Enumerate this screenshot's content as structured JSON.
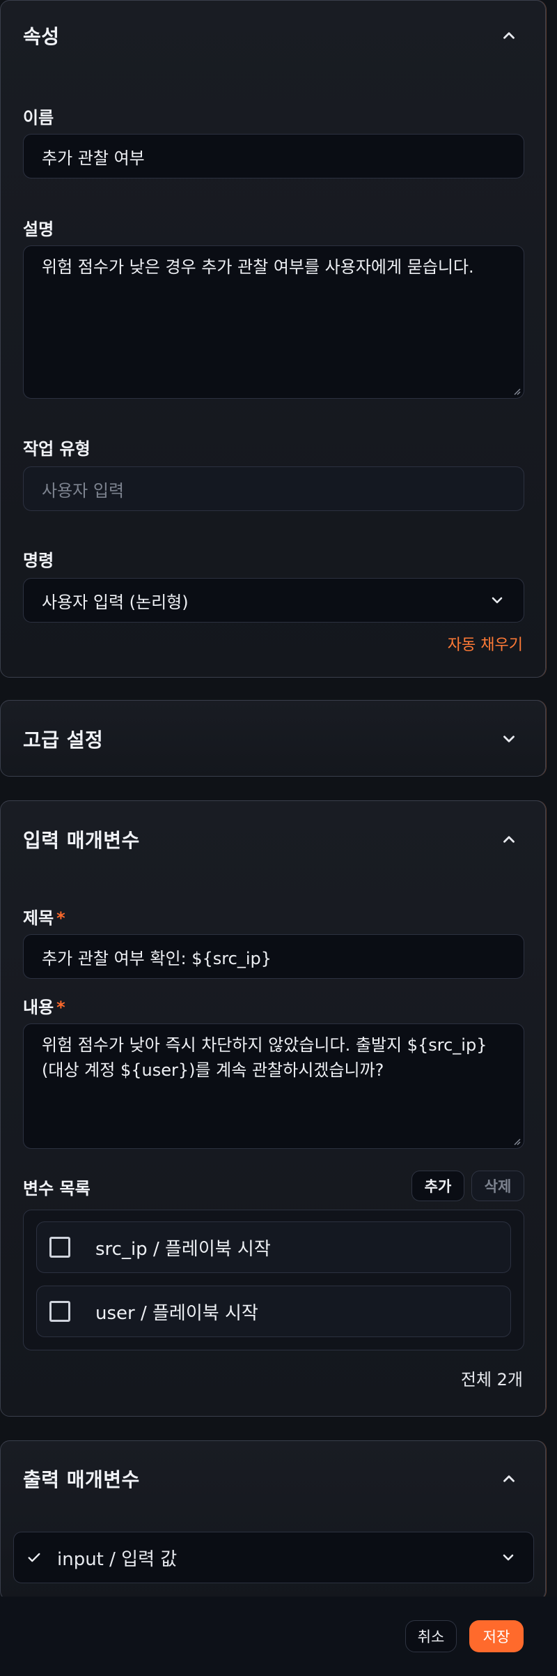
{
  "properties": {
    "title": "속성",
    "name_label": "이름",
    "name_value": "추가 관찰 여부",
    "desc_label": "설명",
    "desc_value": "위험 점수가 낮은 경우 추가 관찰 여부를 사용자에게 묻습니다.",
    "task_type_label": "작업 유형",
    "task_type_placeholder": "사용자 입력",
    "command_label": "명령",
    "command_value": "사용자 입력 (논리형)",
    "autofill_label": "자동 채우기"
  },
  "advanced": {
    "title": "고급 설정"
  },
  "input_params": {
    "title": "입력 매개변수",
    "subject_label": "제목",
    "subject_value": "추가 관찰 여부 확인: ${src_ip}",
    "content_label": "내용",
    "content_value": "위험 점수가 낮아 즉시 차단하지 않았습니다. 출발지 ${src_ip}(대상 계정 ${user})를 계속 관찰하시겠습니까?",
    "required_mark": "*",
    "var_list_label": "변수 목록",
    "add_label": "추가",
    "delete_label": "삭제",
    "variables": [
      {
        "label": "src_ip / 플레이북 시작"
      },
      {
        "label": "user / 플레이북 시작"
      }
    ],
    "total_label": "전체 2개"
  },
  "output_params": {
    "title": "출력 매개변수",
    "item_label": "input / 입력 값"
  },
  "footer": {
    "cancel_label": "취소",
    "save_label": "저장"
  },
  "colors": {
    "accent": "#ff6a2c",
    "panel_border": "#3a3f4c",
    "input_bg": "#0a0d14"
  }
}
